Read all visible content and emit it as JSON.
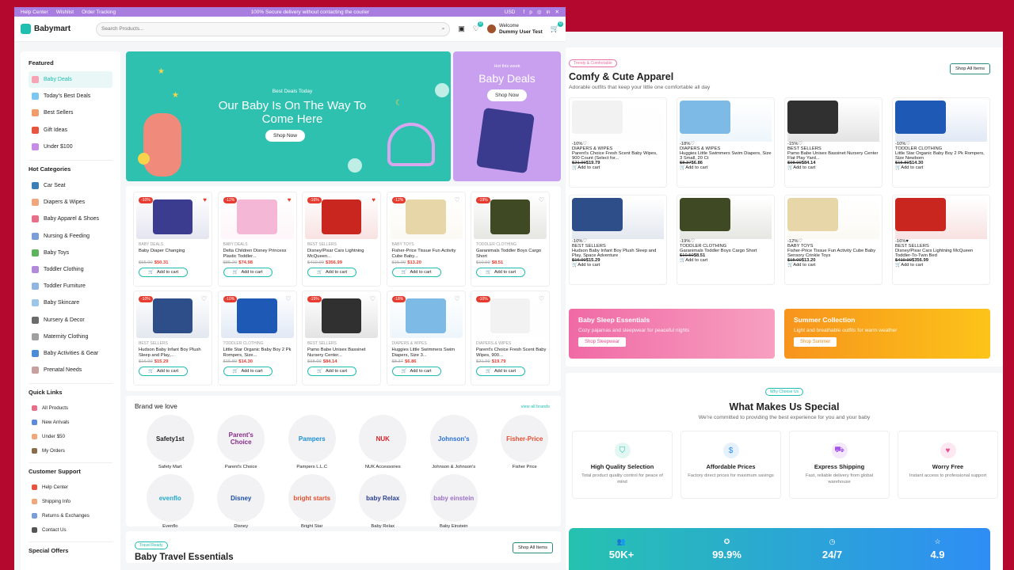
{
  "topbar": {
    "links": [
      "Help Center",
      "Wishlist",
      "Order Tracking"
    ],
    "notice": "100% Secure delivery without contacting the courier",
    "currency": "USD"
  },
  "header": {
    "brand": "Babymart",
    "search_placeholder": "Search Products...",
    "welcome": "Welcome",
    "user": "Dummy User Test",
    "wishlist_count": "0",
    "cart_count": "0"
  },
  "sidebar": {
    "featured_title": "Featured",
    "featured": [
      "Baby Deals",
      "Today's Best Deals",
      "Best Sellers",
      "Gift Ideas",
      "Under $100"
    ],
    "hot_title": "Hot Categories",
    "hot": [
      "Car Seat",
      "Diapers & Wipes",
      "Baby Apparel & Shoes",
      "Nursing & Feeding",
      "Baby Toys",
      "Toddler Clothing",
      "Toddler Furniture",
      "Baby Skincare",
      "Nursery & Decor",
      "Maternity Clothing",
      "Baby Activities & Gear",
      "Prenatal Needs"
    ],
    "quick_title": "Quick Links",
    "quick": [
      "All Products",
      "New Arrivals",
      "Under $50",
      "My Orders"
    ],
    "support_title": "Customer Support",
    "support": [
      "Help Center",
      "Shipping Info",
      "Returns & Exchanges",
      "Contact Us"
    ],
    "offers_title": "Special Offers"
  },
  "hero": {
    "sub": "Best Deals Today",
    "title": "Our Baby Is On The Way To Come Here",
    "cta": "Shop Now"
  },
  "hero_side": {
    "small": "Hot this week",
    "title": "Baby Deals",
    "cta": "Shop Now"
  },
  "products": [
    {
      "disc": "-10%",
      "cat": "BABY DEALS",
      "name": "Baby Diaper Changing",
      "old": "$55.90",
      "price": "$50.31",
      "fav": true
    },
    {
      "disc": "-12%",
      "cat": "BABY DEALS",
      "name": "Delta Children Disney Princess Plastic Toddler...",
      "old": "$85.20",
      "price": "$74.98",
      "fav": true
    },
    {
      "disc": "-16%",
      "cat": "BEST SELLERS",
      "name": "Disney/Pixar Cars Lightning McQueen...",
      "old": "$419.99",
      "price": "$356.99",
      "fav": true
    },
    {
      "disc": "-12%",
      "cat": "BABY TOYS",
      "name": "Fisher-Price Tissue Fun Activity Cube Baby...",
      "old": "$15.00",
      "price": "$13.20",
      "fav": false
    },
    {
      "disc": "-19%",
      "cat": "TODDLER CLOTHING",
      "name": "Garanimals Toddler Boys Cargo Short",
      "old": "$10.50",
      "price": "$8.51",
      "fav": false
    },
    {
      "disc": "-10%",
      "cat": "BEST SELLERS",
      "name": "Hudson Baby Infant Boy Plush Sleep and Play,...",
      "old": "$16.99",
      "price": "$15.29",
      "fav": false
    },
    {
      "disc": "-10%",
      "cat": "TODDLER CLOTHING",
      "name": "Little Star Organic Baby Boy 2 Pk Rompers, Size...",
      "old": "$15.89",
      "price": "$14.30",
      "fav": false
    },
    {
      "disc": "-15%",
      "cat": "BEST SELLERS",
      "name": "Pamo Babe Unisex Bassinet Nursery Center...",
      "old": "$98.99",
      "price": "$84.14",
      "fav": false
    },
    {
      "disc": "-18%",
      "cat": "DIAPERS & WIPES",
      "name": "Huggies Little Swimmers Swim Diapers, Size 3...",
      "old": "$8.37",
      "price": "$6.86",
      "fav": false
    },
    {
      "disc": "-10%",
      "cat": "DIAPERS & WIPES",
      "name": "Parent's Choice Fresh Scent Baby Wipes, 900...",
      "old": "$21.99",
      "price": "$19.79",
      "fav": false
    }
  ],
  "add_to_cart": "Add to cart",
  "brands": {
    "title": "Brand we love",
    "view_all": "view all brands",
    "items": [
      "Safety Mart",
      "Parent's Choice",
      "Pampers L.L.C",
      "NUK Accessories",
      "Johnson & Johnson's",
      "Fisher Price",
      "Evenflo",
      "Disney",
      "Bright Star",
      "Baby Relax",
      "Baby Einstein"
    ],
    "logos": [
      "Safety1st",
      "Parent's Choice",
      "Pampers",
      "NUK",
      "Johnson's",
      "Fisher-Price",
      "evenflo",
      "Disney",
      "bright starts",
      "baby Relax",
      "baby einstein"
    ]
  },
  "travel": {
    "tag": "Travel Ready",
    "title": "Baby Travel Essentials",
    "cta": "Shop All Items"
  },
  "comfy": {
    "tag": "Trendy & Comfortable",
    "title": "Comfy & Cute Apparel",
    "desc": "Adorable outfits that keep your little one comfortable all day",
    "cta": "Shop All Items",
    "items": [
      {
        "disc": "-10%",
        "cat": "DIAPERS & WIPES",
        "name": "Parent's Choice Fresh Scent Baby Wipes, 900 Count (Select for...",
        "old": "$21.99",
        "price": "$19.79",
        "fav": false
      },
      {
        "disc": "-18%",
        "cat": "DIAPERS & WIPES",
        "name": "Huggies Little Swimmers Swim Diapers, Size 3 Small, 20 Ct",
        "old": "$8.37",
        "price": "$6.86",
        "fav": false
      },
      {
        "disc": "-15%",
        "cat": "BEST SELLERS",
        "name": "Pamo Babe Unisex Bassinet Nursery Center Flat Play Yard...",
        "old": "$98.99",
        "price": "$84.14",
        "fav": false
      },
      {
        "disc": "-10%",
        "cat": "TODDLER CLOTHING",
        "name": "Little Star Organic Baby Boy 2 Pk Rompers, Size Newborn",
        "old": "$15.89",
        "price": "$14.30",
        "fav": false
      },
      {
        "disc": "-10%",
        "cat": "BEST SELLERS",
        "name": "Hudson Baby Infant Boy Plush Sleep and Play, Space Adventure",
        "old": "$16.99",
        "price": "$15.29",
        "fav": false
      },
      {
        "disc": "-19%",
        "cat": "TODDLER CLOTHING",
        "name": "Garanimals Toddler Boys Cargo Short",
        "old": "$10.50",
        "price": "$8.51",
        "fav": false
      },
      {
        "disc": "-12%",
        "cat": "BABY TOYS",
        "name": "Fisher-Price Tissue Fun Activity Cube Baby Sensory Crinkle Toys",
        "old": "$15.00",
        "price": "$13.20",
        "fav": false
      },
      {
        "disc": "-16%",
        "cat": "BEST SELLERS",
        "name": "Disney/Pixar Cars Lightning McQueen Toddler-To-Twin Bed",
        "old": "$419.99",
        "price": "$356.99",
        "fav": true
      }
    ]
  },
  "banners": [
    {
      "title": "Baby Sleep Essentials",
      "text": "Cozy pajamas and sleepwear for peaceful nights",
      "cta": "Shop Sleepwear"
    },
    {
      "title": "Summer Collection",
      "text": "Light and breathable outfits for warm weather",
      "cta": "Shop Summer"
    }
  ],
  "why": {
    "tag": "Why Choose Us",
    "title": "What Makes Us Special",
    "desc": "We're committed to providing the best experience for you and your baby",
    "features": [
      {
        "title": "High Quality Selection",
        "text": "Total product quality control for peace of mind"
      },
      {
        "title": "Affordable Prices",
        "text": "Factory direct prices for maximum savings"
      },
      {
        "title": "Express Shipping",
        "text": "Fast, reliable delivery from global warehouse"
      },
      {
        "title": "Worry Free",
        "text": "Instant access to professional support"
      }
    ],
    "stats": [
      "50K+",
      "99.9%",
      "24/7",
      "4.9"
    ]
  },
  "colors": {
    "accent": "#1fbfb0",
    "topbar": "#a97ce0",
    "sale": "#e63b2e",
    "bg": "#b5082e"
  }
}
